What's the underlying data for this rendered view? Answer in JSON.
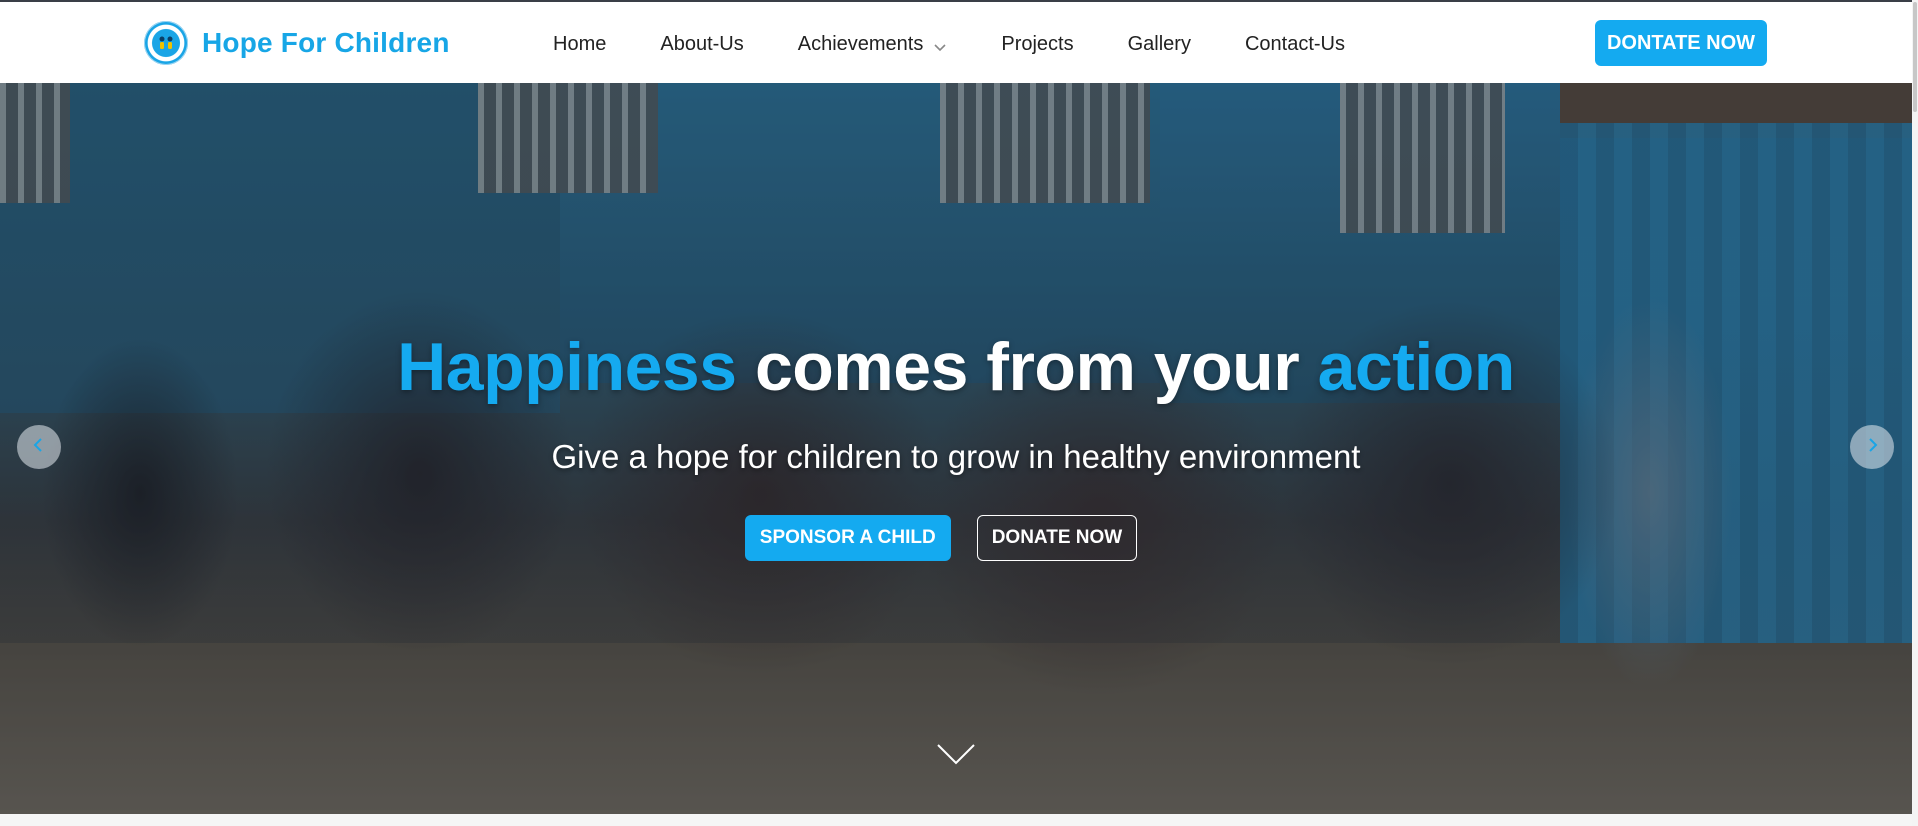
{
  "brand": {
    "name": "Hope For Children",
    "logo_icon": "hope-for-children-logo-icon"
  },
  "nav": {
    "items": [
      {
        "label": "Home"
      },
      {
        "label": "About-Us"
      },
      {
        "label": "Achievements",
        "icon": "chevron-down-icon"
      },
      {
        "label": "Projects"
      },
      {
        "label": "Gallery"
      },
      {
        "label": "Contact-Us"
      }
    ],
    "donate_label": "DONTATE NOW"
  },
  "hero": {
    "headline_part1": "Happiness",
    "headline_part2": " comes from your ",
    "headline_part3": "action",
    "subtitle": "Give a hope for children to grow in healthy environment",
    "sponsor_label": "SPONSOR A CHILD",
    "donate_label": "DONATE NOW",
    "prev_icon": "chevron-left-icon",
    "next_icon": "chevron-right-icon",
    "scroll_icon": "chevron-down-icon"
  },
  "colors": {
    "accent": "#14aaf0",
    "brand_text": "#17a6e6",
    "nav_text": "#222222"
  }
}
